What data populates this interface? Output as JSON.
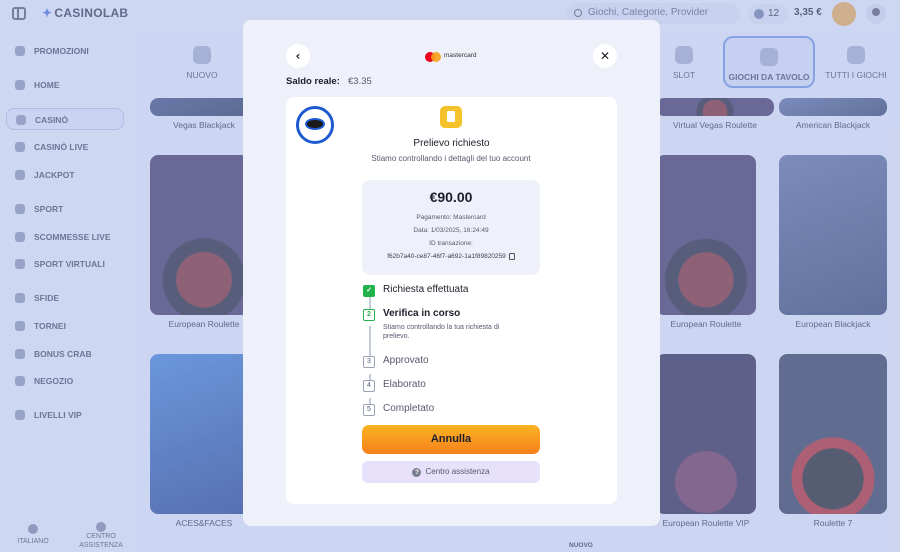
{
  "app": {
    "logo": "CASINOLAB",
    "search_placeholder": "Giochi, Categorie, Provider",
    "coins": "12",
    "balance": "3,35 €"
  },
  "sidebar": {
    "items": [
      "PROMOZIONI",
      "HOME",
      "CASINÒ",
      "CASINÒ LIVE",
      "JACKPOT",
      "SPORT",
      "SCOMMESSE LIVE",
      "SPORT VIRTUALI",
      "SFIDE",
      "TORNEI",
      "BONUS CRAB",
      "NEGOZIO",
      "LIVELLI VIP"
    ],
    "language": "ITALIANO",
    "help": "CENTRO ASSISTENZA"
  },
  "categories": [
    "NUOVO",
    "SLOT",
    "GIOCHI DA TAVOLO",
    "TUTTI I GIOCHI"
  ],
  "games": {
    "row1": [
      "Vegas Blackjack",
      "Virtual Vegas Roulette",
      "American Blackjack"
    ],
    "row2": [
      "European Roulette",
      "European Roulette",
      "European Blackjack"
    ],
    "row3": [
      "ACES&FACES",
      "European Roulette VIP",
      "Roulette 7"
    ],
    "bottom_label": "NUOVO"
  },
  "modal": {
    "back_icon": "‹",
    "close_icon": "✕",
    "payment_brand": "mastercard",
    "saldo_label": "Saldo reale:",
    "saldo_value": "€3.35",
    "title": "Prelievo richiesto",
    "subtitle": "Stiamo controllando i dettagli del tuo account",
    "amount": "€90.00",
    "payment": "Pagamento: Mastercard",
    "date": "Data: 1/03/2025, 16:24:49",
    "tx_label": "ID transazione:",
    "tx_id": "f62b7a40-ce87-46f7-a692-1a1f89820259",
    "steps": [
      {
        "num": "✓",
        "label": "Richiesta effettuata",
        "state": "done"
      },
      {
        "num": "2",
        "label": "Verifica in corso",
        "state": "current"
      },
      {
        "num": "3",
        "label": "Approvato",
        "state": "pending"
      },
      {
        "num": "4",
        "label": "Elaborato",
        "state": "pending"
      },
      {
        "num": "5",
        "label": "Completato",
        "state": "pending"
      }
    ],
    "step_desc": "Stiamo controllando la tua richiesta di prelievo.",
    "cancel_label": "Annulla",
    "help_label": "Centro assistenza",
    "help_icon": "?"
  },
  "colors": {
    "accent_orange": "#f7941d",
    "step_green": "#22b24c",
    "mastercard_red": "#eb001b",
    "mastercard_yellow": "#f79e1b"
  }
}
